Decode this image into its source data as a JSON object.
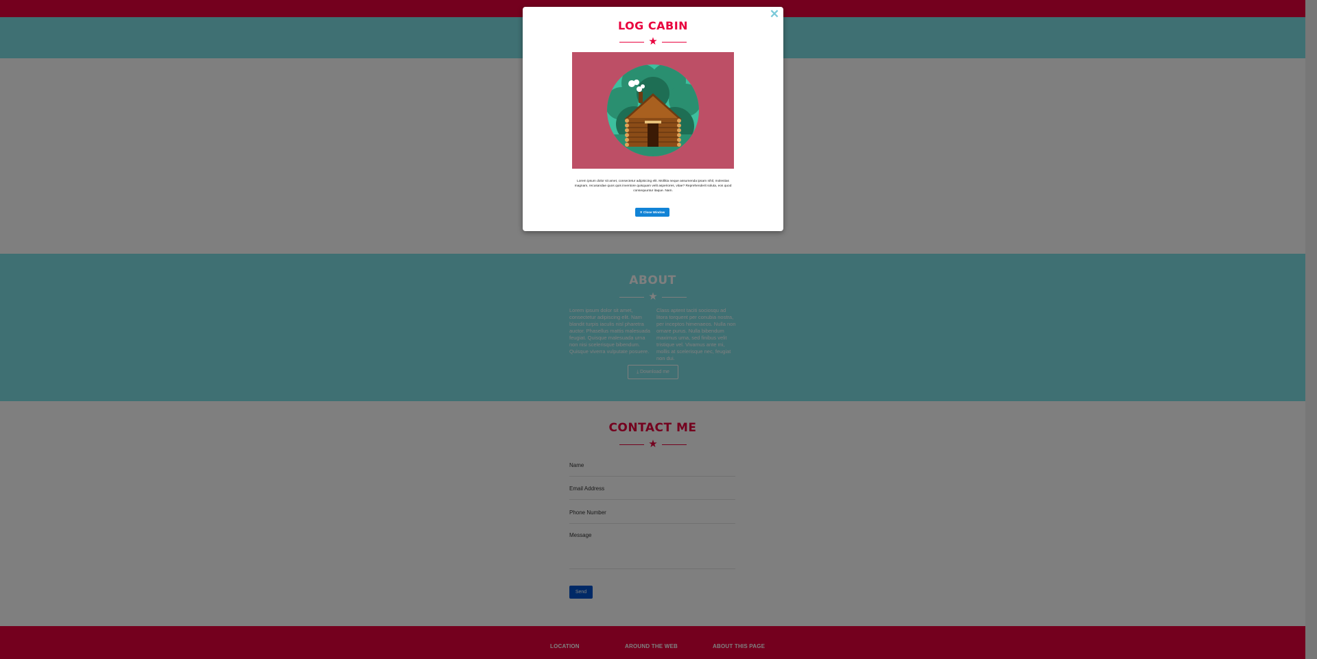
{
  "about": {
    "title": "ABOUT",
    "col1": "Lorem ipsum dolor sit amet, consectetur adipiscing elit. Nam blandit turpis iaculis nisl pharetra auctor. Phasellus mattis malesuada feugiat. Quisque malesuada urna non nisi scelerisque bibendum. Quisque viverra vulputate posuere.",
    "col2": "Class aptent taciti sociosqu ad litora torquent per conubia nostra, per inceptos himenaeos. Nulla non ornare purus. Nulla bibendum maximus urna, sed finibus velit tristique vel. Vivamus ante mi, mollis at scelerisque nec, feugiat non dui.",
    "download_label": "Download me",
    "download_icon": "download-icon"
  },
  "contact": {
    "title": "CONTACT ME",
    "fields": {
      "name": "Name",
      "email": "Email Address",
      "phone": "Phone Number",
      "message": "Message"
    },
    "send_label": "Send"
  },
  "footer": {
    "columns": [
      "LOCATION",
      "AROUND THE WEB",
      "ABOUT THIS PAGE"
    ]
  },
  "modal": {
    "title": "LOG CABIN",
    "close_icon": "close-icon",
    "text": "Lorem ipsum dolor sit amet, consectetur adipisicing elit. Mollitia neque assumenda ipsam nihil, molestias magnam, recusandae quos quis inventore quisquam velit asperiores, vitae? Reprehenderit soluta, eos quod consequuntur itaque. Nam.",
    "button_label": "Close Window",
    "button_icon": "times-icon"
  },
  "colors": {
    "brand_red": "#e8003d",
    "teal": "#7ee0e6",
    "modal_image_bg": "#bd4f66",
    "button_blue": "#1183d6"
  }
}
